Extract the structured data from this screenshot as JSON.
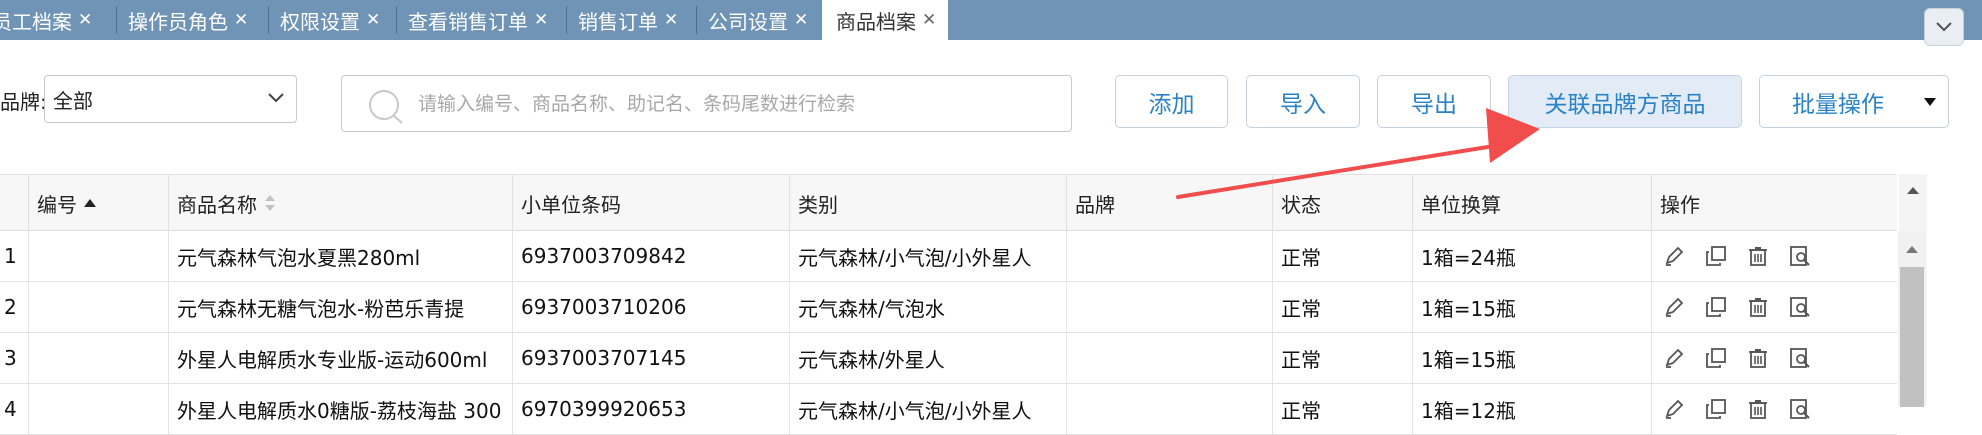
{
  "tabs": [
    {
      "label": "员工档案",
      "active": false
    },
    {
      "label": "操作员角色",
      "active": false
    },
    {
      "label": "权限设置",
      "active": false
    },
    {
      "label": "查看销售订单",
      "active": false
    },
    {
      "label": "销售订单",
      "active": false
    },
    {
      "label": "公司设置",
      "active": false
    },
    {
      "label": "商品档案",
      "active": true
    }
  ],
  "tab_close_glyph": "✕",
  "toolbar": {
    "brand_label": "品牌:",
    "brand_value": "全部",
    "search_placeholder": "请输入编号、商品名称、助记名、条码尾数进行检索",
    "add_label": "添加",
    "import_label": "导入",
    "export_label": "导出",
    "link_brand_label": "关联品牌方商品",
    "batch_label": "批量操作"
  },
  "table": {
    "headers": {
      "code": "编号",
      "name": "商品名称",
      "barcode": "小单位条码",
      "category": "类别",
      "brand": "品牌",
      "status": "状态",
      "unit": "单位换算",
      "ops": "操作"
    },
    "rows": [
      {
        "idx": "1",
        "code": "",
        "name": "元气森林气泡水夏黑280ml",
        "barcode": "6937003709842",
        "category": "元气森林/小气泡/小外星人",
        "brand": "",
        "status": "正常",
        "unit": "1箱=24瓶"
      },
      {
        "idx": "2",
        "code": "",
        "name": "元气森林无糖气泡水-粉芭乐青提",
        "barcode": "6937003710206",
        "category": "元气森林/气泡水",
        "brand": "",
        "status": "正常",
        "unit": "1箱=15瓶"
      },
      {
        "idx": "3",
        "code": "",
        "name": "外星人电解质水专业版-运动600ml",
        "barcode": "6937003707145",
        "category": "元气森林/外星人",
        "brand": "",
        "status": "正常",
        "unit": "1箱=15瓶"
      },
      {
        "idx": "4",
        "code": "",
        "name": "外星人电解质水0糖版-荔枝海盐 300",
        "barcode": "6970399920653",
        "category": "元气森林/小气泡/小外星人",
        "brand": "",
        "status": "正常",
        "unit": "1箱=12瓶"
      }
    ]
  },
  "colors": {
    "tabbar_bg": "#6f94b6",
    "accent_blue": "#2a83c6",
    "highlight_btn_bg": "#e3ebf7",
    "arrow_red": "#f24d4d"
  },
  "icons": {
    "sort_asc": "sort-asc-icon",
    "sort_both": "sort-both-icon",
    "ops": [
      "edit-icon",
      "copy-icon",
      "delete-icon",
      "view-icon"
    ]
  }
}
